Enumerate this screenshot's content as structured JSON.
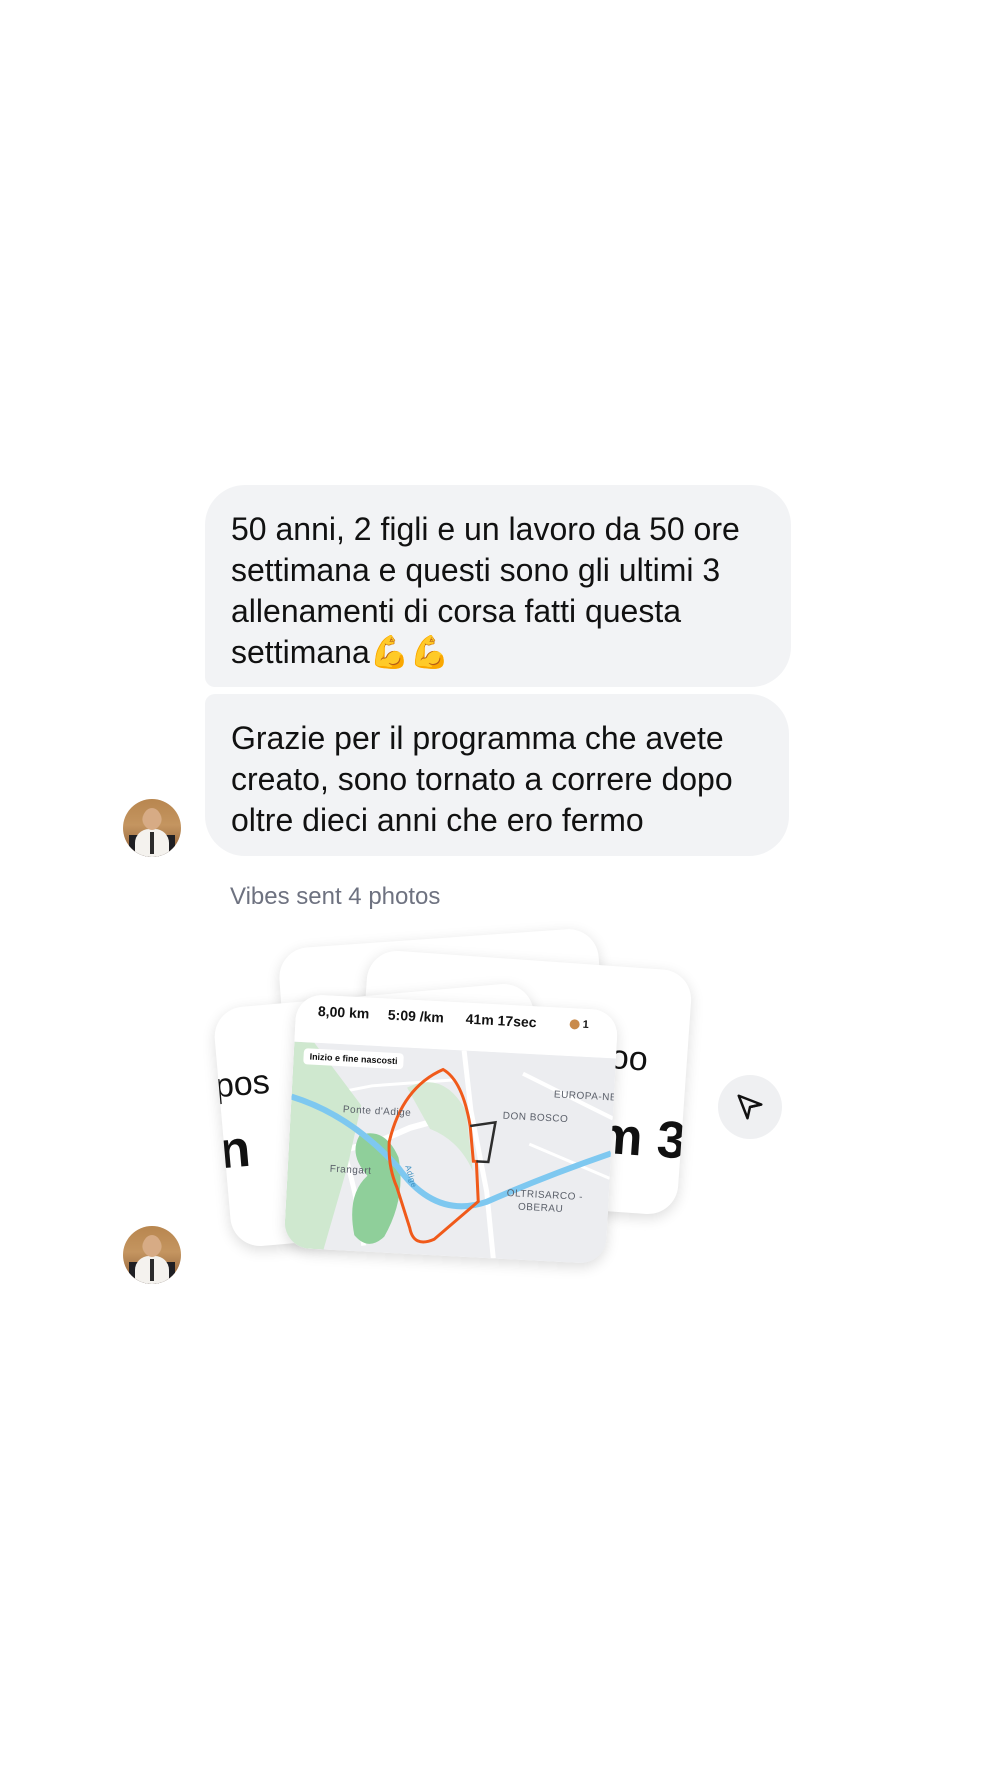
{
  "messages": [
    {
      "text": "50 anni, 2 figli e un lavoro da 50 ore\nsettimana e questi sono gli ultimi 3\nallenamenti di corsa fatti questa\nsettimana💪💪"
    },
    {
      "text": "Grazie per il programma che avete\ncreato, sono tornato a correre dopo\noltre dieci anni che ero fermo"
    }
  ],
  "photos_caption": "Vibes sent 4 photos",
  "photo_cards": {
    "left_text_top": "pos",
    "left_text_big": "n",
    "right_text_top": "oo",
    "right_text_big": "m 3",
    "front": {
      "distance": "8,00 km",
      "pace": "5:09 /km",
      "time": "41m 17sec",
      "badge": "1",
      "map_notice": "Inizio e fine nascosti",
      "labels": {
        "ponte": "Ponte d'Adige",
        "frangart": "Frangart",
        "don_bosco": "DON BOSCO",
        "europa": "EUROPA-NE",
        "oltrisarco_1": "OLTRISARCO -",
        "oltrisarco_2": "OBERAU",
        "river": "Adige"
      }
    }
  },
  "icons": {
    "send": "send-icon",
    "avatar": "avatar"
  },
  "colors": {
    "bubble": "#f2f3f5",
    "caption": "#6e7280",
    "route": "#f05a1a",
    "river": "#7ec8f0",
    "park": "#8fcf9a"
  }
}
